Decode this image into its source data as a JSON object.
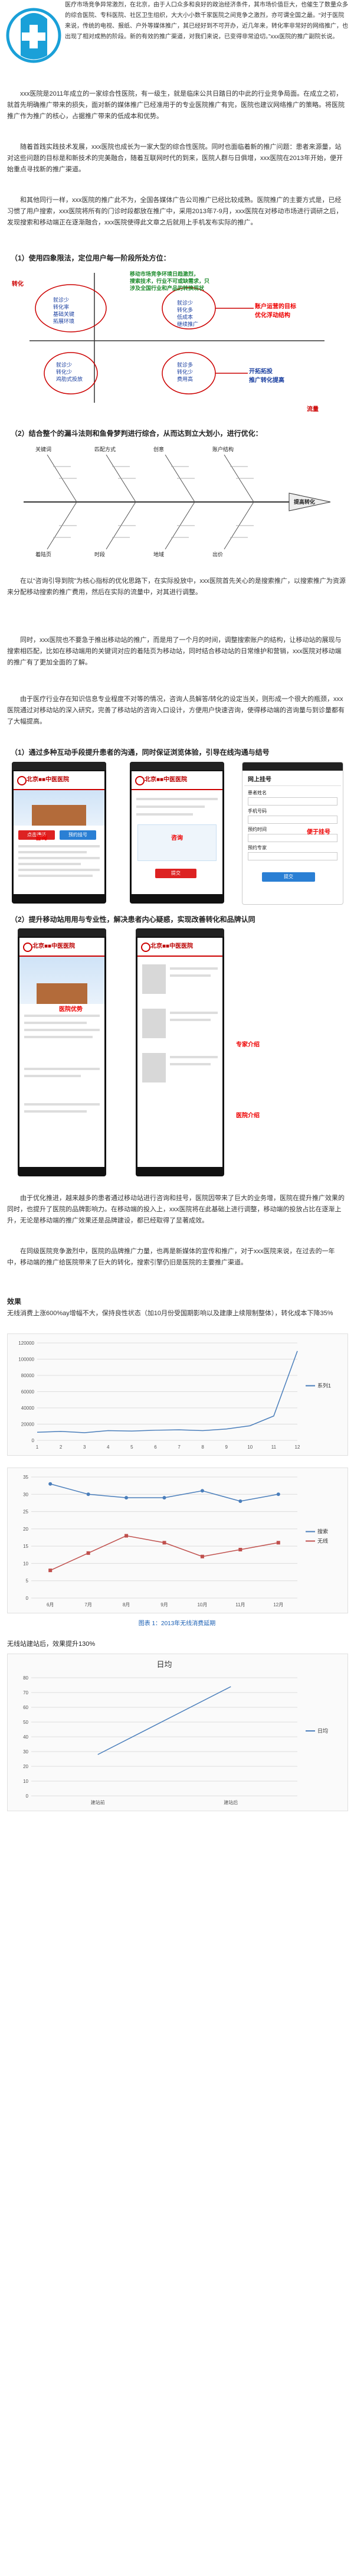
{
  "intro": {
    "para1": "医疗市场竞争异常激烈，在北京，由于人口众多和良好的政治经济条件，其市场价值巨大，也催生了数量众多的综合医院、专科医院、社区卫生组织，大大小小数千家医院之间竞争之激烈，亦可谓全国之最。“对于医院来说，传统的电视、报纸、户外等媒体推广，其已经好到不可开办，近几年来，转化率非常好的网络推广，也出现了相对成熟的阶段。新的有效的推广渠道，对我们来说，已变得非常迫切。”xxx医院的推广副院长说。"
  },
  "sections": [
    "xxx医院是2011年成立的一家综合性医院，有一级生，就是临床公共日踏日的中此的行业竞争局面。在成立之初，就首先明确推广带来的损失，面对新的媒体推广已经准用于的专业医院推广有完，医院也建议网络推广的策略。将医院推广作为推广的核心，占据推广带来的低成本和优势。",
    "随着首践实践技术发展，xxx医院也成长为一家大型的综合性医院。同时也面临着新的推广问题：患者来源量，站对这些问题的目标是和新技术的完美融合，随着互联网时代的到来，医院人群与日俱增，xxx医院在2013年开始，便开始重点寻找新的推广渠道。",
    "和其他同行一样，xxx医院的推广此不为，全国各媒体广告公司推广已经比较成熟。医院推广的主要方式是，已经习惯了用户搜索，xxx医院将所有的门诊时段都放在推广中，采用2013年7-9月，xxx医院在对移动市场进行调研之后，发现搜索和移动端正在逐渐融合，xxx医院使得此文章之后就用上手机发布实际的推广。"
  ],
  "heading1": "（1）使用四象限法，定位用户每一阶段所处方位：",
  "quadrant": {
    "y_label": "转化",
    "x_label": "流量",
    "q_tl": [
      "挖掘客户转化率",
      "提升产品特性和",
      "以最优解决方案"
    ],
    "q_tl_sub": [
      "就诊少",
      "转化率",
      "基础关键",
      "拓展环境"
    ],
    "q_tr_top": [
      "移动市场竞争环境日趋激烈，",
      "搜索技术，行业不可或缺需求，只",
      "涉及全国行业和产品的转换现状"
    ],
    "q_tr_box": [
      "就诊少",
      "转化多",
      "低成本",
      "继续推广"
    ],
    "q_tr_red": "账户运营的目标",
    "q_tr_red2": "优化浮动结构",
    "q_bl": [
      "就诊少",
      "转化少",
      "鸡肋式投放"
    ],
    "q_br_box": [
      "就诊多",
      "转化少",
      "费用高"
    ],
    "q_br_red": [
      "开拓拓投",
      "推广转化提高"
    ]
  },
  "heading2": "（2）结合整个的漏斗法则和鱼骨梦判进行综合，从而达到立大划小，进行优化：",
  "fishbone": {
    "head": "提高转化",
    "bones_top": [
      "关键词",
      "匹配方式",
      "创意",
      "账户结构"
    ],
    "bones_bottom": [
      "着陆页",
      "时段",
      "地域",
      "出价"
    ]
  },
  "body2": [
    "在以“咨询引导到院”为核心指标的优化思路下，在实际投放中，xxx医院首先关心的是搜索推广，以搜索推广为资源来分配移动搜索的推广费用，然后在实际的流量中，对其进行调整。",
    "同时，xxx医院也不要急于推出移动站的推广，而是用了一个月的时间，调整搜索账户的结构，让移动站的展现与搜索相匹配，比如在移动端用的关键词对应的着陆页为移动站，同时结合移动站的日常维护和营销，xxx医院对移动端的推广有了更加全面的了解。",
    "由于医疗行业存在知识信息专业程度不对等的情况，咨询人员解答/转化的设定当关，则形成一个很大的瓶颈，xxx医院通过对移动站的深入研究，完善了移动站的咨询入口设计，方便用户快速咨询，使得移动端的咨询量与到诊量都有了大幅提高。"
  ],
  "heading3": "（1）通过多种互动手段提升患者的沟通，同时保证浏览体验，引导在线沟通与结号",
  "phones1": {
    "hospital": "北京■■中医医院",
    "tabs": [
      "推荐",
      "专家",
      "导航"
    ],
    "btn1": "点击通话",
    "btn2": "预约挂号",
    "form_title": "网上挂号",
    "fields": [
      "患者姓名",
      "手机号码",
      "预约时间",
      "预约专家"
    ],
    "submit": "提交",
    "annot_left": "咨询",
    "annot_mid": "咨询",
    "annot_right": "便于挂号"
  },
  "heading4": "（2）提升移动站用用与专业性，解决患者内心疑惑，实现改善转化和品牌认同",
  "phones2": {
    "hospital": "北京■■中医医院",
    "annot_a": "医院优势",
    "annot_b": "专家介绍",
    "annot_c": "医院介绍"
  },
  "body3": [
    "由于优化推进，越来越多的患者通过移动站进行咨询和挂号，医院因带来了巨大的业务增，医院在提升推广效果的同时，也提升了医院的品牌影响力。在移动端的投入上，xxx医院将在此基础上进行调整，移动端的投放占比在逐渐上升，无论是移动端的推广效果还是品牌建设，都已经取得了显著成效。",
    "在同级医院竞争激烈中，医院的品牌推广力量，也再是新媒体的宣传和推广，对于xxx医院来说，在过去的一年中，移动端的推广给医院带来了巨大的转化，搜索引擎仍旧是医院的主要推广渠道。"
  ],
  "effects_heading": "效果",
  "effects_text": "无线消费上涨600%ay增幅不大，保持良性状态（加10月份受国期影响以及建康上续限制整体），转化成本下降35%",
  "chart1": {
    "type": "line",
    "categories": [
      "1",
      "2",
      "3",
      "4",
      "5",
      "6",
      "7",
      "8",
      "9",
      "10",
      "11",
      "12"
    ],
    "series": [
      {
        "name": "系列1",
        "values": [
          10000,
          11000,
          9500,
          12000,
          11500,
          12500,
          13000,
          12000,
          14000,
          18000,
          30000,
          110000
        ]
      }
    ],
    "ylim": [
      0,
      120000
    ],
    "yticks": [
      "0",
      "20000",
      "40000",
      "60000",
      "80000",
      "100000",
      "120000"
    ]
  },
  "chart2": {
    "type": "line",
    "categories": [
      "6月",
      "7月",
      "8月",
      "9月",
      "10月",
      "11月",
      "12月"
    ],
    "series": [
      {
        "name": "搜索",
        "values": [
          33,
          30,
          29,
          29,
          31,
          28,
          30
        ]
      },
      {
        "name": "无线",
        "values": [
          8,
          13,
          18,
          16,
          12,
          14,
          16
        ]
      }
    ],
    "ylim": [
      0,
      35
    ],
    "yticks": [
      "0",
      "5",
      "10",
      "15",
      "20",
      "25",
      "30",
      "35"
    ],
    "caption": "图表 1：2013年无线消费延期"
  },
  "after_text": "无线站建站后，效果提升130%",
  "chart3": {
    "type": "line",
    "title": "日均",
    "categories": [
      "建站前",
      "建站后"
    ],
    "series": [
      {
        "name": "日均",
        "values": [
          28,
          74
        ]
      }
    ],
    "ylim": [
      0,
      80
    ],
    "yticks": [
      "0",
      "10",
      "20",
      "30",
      "40",
      "50",
      "60",
      "70",
      "80"
    ]
  }
}
